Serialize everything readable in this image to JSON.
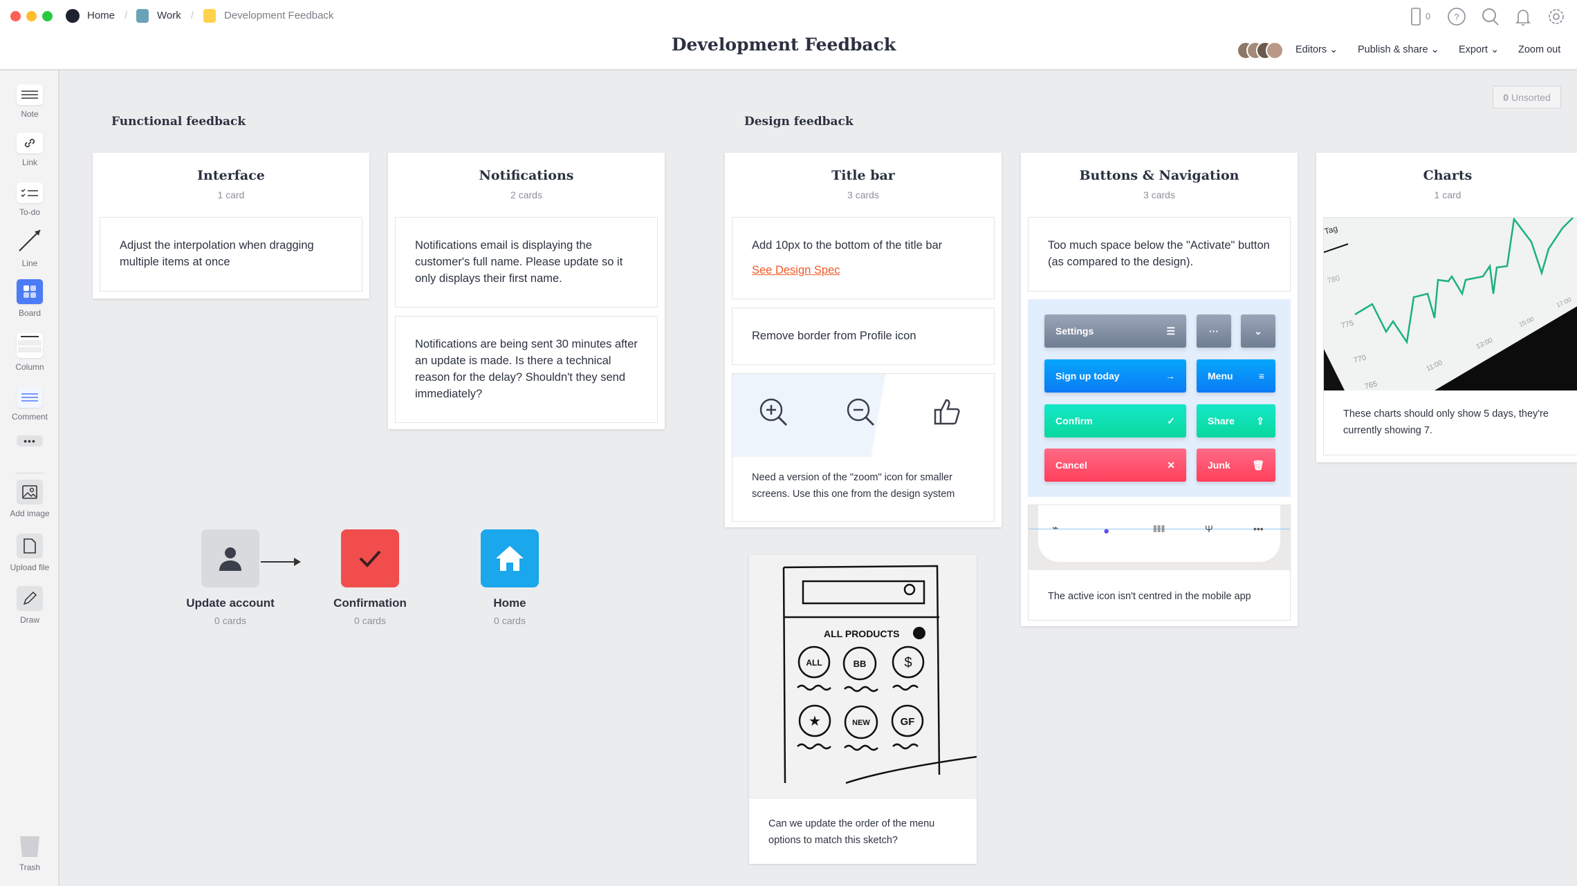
{
  "breadcrumb": [
    {
      "label": "Home",
      "color": "#1f2330"
    },
    {
      "label": "Work",
      "color": "#6aa3b6"
    },
    {
      "label": "Development Feedback",
      "color": "#ffd24c"
    }
  ],
  "header": {
    "title": "Development Feedback",
    "device_count": "0",
    "editors": "Editors",
    "publish": "Publish & share",
    "export": "Export",
    "zoom_out": "Zoom out"
  },
  "unsorted": {
    "count": "0",
    "label": "Unsorted"
  },
  "sidebar": {
    "items": [
      {
        "label": "Note",
        "icon": "note-icon"
      },
      {
        "label": "Link",
        "icon": "link-icon"
      },
      {
        "label": "To-do",
        "icon": "todo-icon"
      },
      {
        "label": "Line",
        "icon": "line-icon"
      },
      {
        "label": "Board",
        "icon": "board-icon"
      },
      {
        "label": "Column",
        "icon": "column-icon"
      },
      {
        "label": "Comment",
        "icon": "comment-icon"
      },
      {
        "label": "Add image",
        "icon": "image-icon"
      },
      {
        "label": "Upload file",
        "icon": "file-icon"
      },
      {
        "label": "Draw",
        "icon": "pencil-icon"
      }
    ],
    "trash": "Trash"
  },
  "sections": {
    "functional": "Functional feedback",
    "design": "Design feedback"
  },
  "columns": {
    "interface": {
      "title": "Interface",
      "count": "1 card",
      "cards": [
        "Adjust the interpolation when dragging multiple items at once"
      ]
    },
    "notifications": {
      "title": "Notifications",
      "count": "2 cards",
      "cards": [
        "Notifications email is displaying the customer's full name. Please update so it only displays their first name.",
        "Notifications are being sent 30 minutes after an update is made. Is there a technical reason for the delay? Shouldn't they send immediately?"
      ]
    },
    "titlebar": {
      "title": "Title bar",
      "count": "3 cards",
      "cards": [
        "Add 10px to the bottom of the title bar",
        "Remove border from Profile icon",
        "Need a version of the \"zoom\" icon for smaller screens. Use this one from the design system"
      ],
      "link": "See Design Spec"
    },
    "buttons": {
      "title": "Buttons & Navigation",
      "count": "3 cards",
      "cards": [
        "Too much space below the \"Activate\" button (as compared to the design).",
        "The active icon isn't centred in the mobile app"
      ],
      "sample_buttons": [
        "Settings",
        "···",
        "Sign up today",
        "Menu",
        "Confirm",
        "Share",
        "Cancel",
        "Junk"
      ]
    },
    "charts": {
      "title": "Charts",
      "count": "1 card",
      "cards": [
        "These charts should only show 5 days, they're currently showing 7."
      ],
      "image_labels": [
        "Tag",
        "780",
        "775",
        "770",
        "765",
        "11:00",
        "13:00",
        "15:00",
        "17:00"
      ]
    }
  },
  "sketch": {
    "caption": "Can we update the order of the menu options to match this sketch?",
    "labels": [
      "ALL PRODUCTS",
      "ALL",
      "BB",
      "$",
      "NEW",
      "GF"
    ]
  },
  "boards": [
    {
      "label": "Update account",
      "count": "0 cards",
      "color": "#d9dadd"
    },
    {
      "label": "Confirmation",
      "count": "0 cards",
      "color": "#f24d4d"
    },
    {
      "label": "Home",
      "count": "0 cards",
      "color": "#1aa7ec"
    }
  ]
}
